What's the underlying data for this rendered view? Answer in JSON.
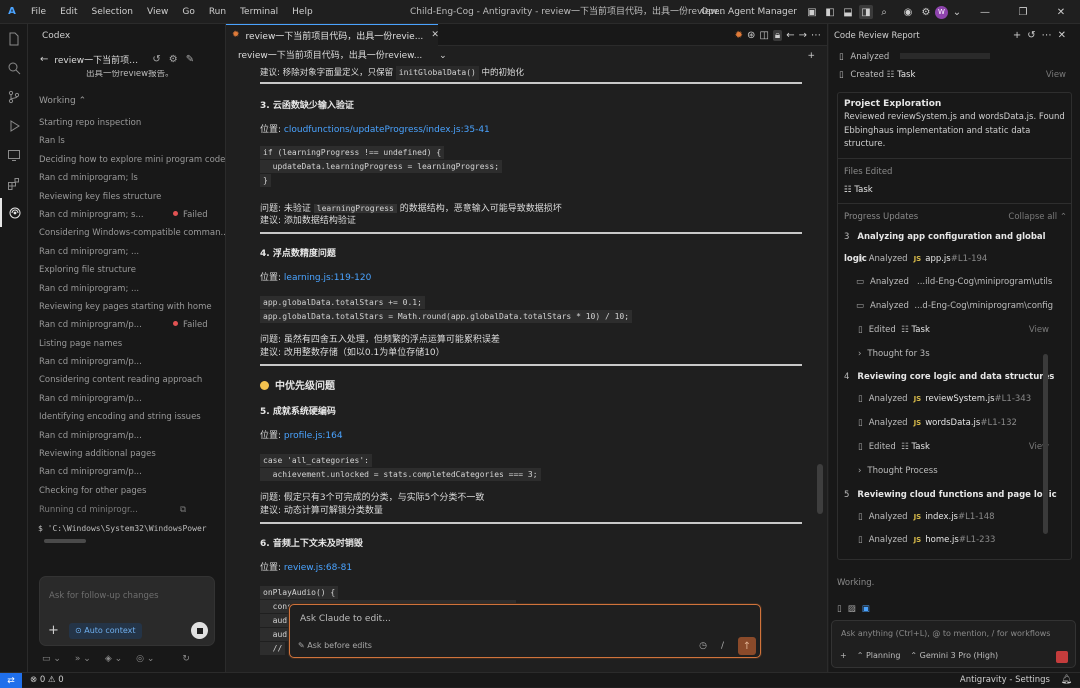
{
  "titlebar": {
    "menu": [
      "File",
      "Edit",
      "Selection",
      "View",
      "Go",
      "Run",
      "Terminal",
      "Help"
    ],
    "window_title": "Child-Eng-Cog - Antigravity - review一下当前项目代码，出具一份review...",
    "agent_manager": "Open Agent Manager",
    "avatar_letter": "W"
  },
  "left": {
    "header": "Codex",
    "session_title": "review一下当前项目...",
    "clipped_text": "出具一份review报告。",
    "working_label": "Working",
    "steps": [
      {
        "text": "Starting repo inspection",
        "status": ""
      },
      {
        "text": "Ran ls",
        "status": ""
      },
      {
        "text": "Deciding how to explore mini program code",
        "status": ""
      },
      {
        "text": "Ran cd miniprogram; ls",
        "status": ""
      },
      {
        "text": "Reviewing key files structure",
        "status": ""
      },
      {
        "text": "Ran cd miniprogram; s...",
        "status": "Failed"
      },
      {
        "text": "Considering Windows-compatible comman...",
        "status": ""
      },
      {
        "text": "Ran cd miniprogram; ...",
        "status": ""
      },
      {
        "text": "Exploring file structure",
        "status": ""
      },
      {
        "text": "Ran cd miniprogram; ...",
        "status": ""
      },
      {
        "text": "Reviewing key pages starting with home",
        "status": ""
      },
      {
        "text": "Ran cd miniprogram/p...",
        "status": "Failed"
      },
      {
        "text": "Listing page names",
        "status": ""
      },
      {
        "text": "Ran cd miniprogram/p...",
        "status": ""
      },
      {
        "text": "Considering content reading approach",
        "status": ""
      },
      {
        "text": "Ran cd miniprogram/p...",
        "status": ""
      },
      {
        "text": "Identifying encoding and string issues",
        "status": ""
      },
      {
        "text": "Ran cd miniprogram/p...",
        "status": ""
      },
      {
        "text": "Reviewing additional pages",
        "status": ""
      },
      {
        "text": "Ran cd miniprogram/p...",
        "status": ""
      },
      {
        "text": "Checking for other pages",
        "status": ""
      }
    ],
    "running": "Running cd miniprogr...",
    "terminal_line": "$ 'C:\\Windows\\System32\\WindowsPower",
    "chat_placeholder": "Ask for follow-up changes",
    "auto_context": "Auto context"
  },
  "editor": {
    "tab_title": "review一下当前项目代码，出具一份revie...",
    "breadcrumb": "review一下当前项目代码，出具一份review...",
    "top_line_prefix": "建议: 移除对象字面量定义，只保留",
    "top_line_code": "initGlobalData()",
    "top_line_suffix": "中的初始化",
    "issues": [
      {
        "title": "3. 云函数缺少输入验证",
        "loc_label": "位置: ",
        "loc": "cloudfunctions/updateProgress/index.js:35-41",
        "code": [
          "if (learningProgress !== undefined) {",
          "  updateData.learningProgress = learningProgress;",
          "}"
        ],
        "problem_prefix": "问题: 未验证 ",
        "problem_code": "learningProgress",
        "problem_suffix": " 的数据结构，恶意输入可能导致数据损坏",
        "suggestion": "建议: 添加数据结构验证"
      },
      {
        "title": "4. 浮点数精度问题",
        "loc_label": "位置: ",
        "loc": "learning.js:119-120",
        "code": [
          "app.globalData.totalStars += 0.1;",
          "app.globalData.totalStars = Math.round(app.globalData.totalStars * 10) / 10;"
        ],
        "problem": "问题: 虽然有四舍五入处理，但频繁的浮点运算可能累积误差",
        "suggestion": "建议: 改用整数存储（如以0.1为单位存储10）"
      }
    ],
    "priority_heading": "中优先级问题",
    "issue5": {
      "title": "5. 成就系统硬编码",
      "loc_label": "位置: ",
      "loc": "profile.js:164",
      "code": [
        "case 'all_categories':",
        "  achievement.unlocked = stats.completedCategories === 3;"
      ],
      "problem": "问题: 假定只有3个可完成的分类，与实际5个分类不一致",
      "suggestion": "建议: 动态计算可解锁分类数量"
    },
    "issue6": {
      "title": "6. 音频上下文未及时销毁",
      "loc_label": "位置: ",
      "loc": "review.js:68-81",
      "code": [
        "onPlayAudio() {",
        "  const audioContext = wx.createInnerAudioContext();",
        "  aud",
        "  aud",
        "  //"
      ]
    },
    "claude_placeholder": "Ask Claude to edit...",
    "claude_mode": "Ask before edits"
  },
  "right": {
    "header": "Code Review Report",
    "analyzed": "Analyzed",
    "created": "Created",
    "task": "Task",
    "view": "View",
    "project_title": "Project Exploration",
    "project_body": "Reviewed reviewSystem.js and wordsData.js. Found Ebbinghaus implementation and static data structure.",
    "files_edited": "Files Edited",
    "progress_updates": "Progress Updates",
    "collapse_all": "Collapse all",
    "steps": [
      {
        "num": "3",
        "title": "Analyzing app configuration and global logic",
        "items": [
          {
            "kind": "file",
            "verb": "Analyzed",
            "file": "app.js",
            "lines": "#L1-194"
          },
          {
            "kind": "folder",
            "verb": "Analyzed",
            "path": "...ild-Eng-Cog\\miniprogram\\utils"
          },
          {
            "kind": "folder",
            "verb": "Analyzed",
            "path": "...d-Eng-Cog\\miniprogram\\config"
          },
          {
            "kind": "task",
            "verb": "Edited",
            "task": "Task",
            "view": "View"
          },
          {
            "kind": "thought",
            "text": "Thought for 3s"
          }
        ]
      },
      {
        "num": "4",
        "title": "Reviewing core logic and data structures",
        "items": [
          {
            "kind": "file",
            "verb": "Analyzed",
            "file": "reviewSystem.js",
            "lines": "#L1-343"
          },
          {
            "kind": "file",
            "verb": "Analyzed",
            "file": "wordsData.js",
            "lines": "#L1-132"
          },
          {
            "kind": "task",
            "verb": "Edited",
            "task": "Task",
            "view": "View"
          },
          {
            "kind": "thought",
            "text": "Thought Process"
          }
        ]
      },
      {
        "num": "5",
        "title": "Reviewing cloud functions and page logic",
        "items": [
          {
            "kind": "file",
            "verb": "Analyzed",
            "file": "index.js",
            "lines": "#L1-148"
          },
          {
            "kind": "file",
            "verb": "Analyzed",
            "file": "home.js",
            "lines": "#L1-233"
          }
        ]
      }
    ],
    "working": "Working.",
    "input_placeholder": "Ask anything (Ctrl+L), @ to mention, / for workflows",
    "planning": "Planning",
    "model": "Gemini 3 Pro (High)"
  },
  "status": {
    "problems": "⊗ 0 ⚠ 0",
    "right_text": "Antigravity - Settings"
  }
}
